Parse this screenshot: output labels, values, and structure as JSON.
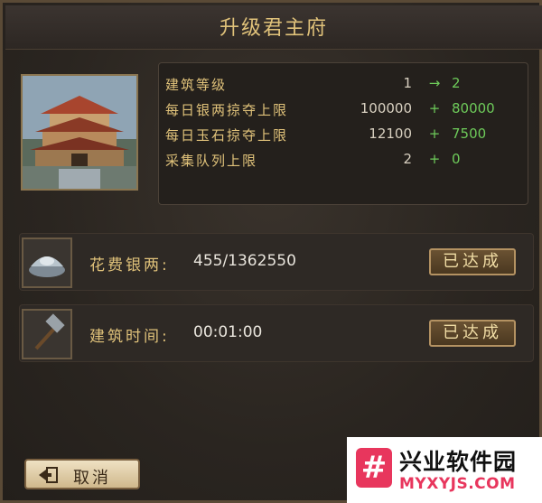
{
  "title": "升级君主府",
  "stats": [
    {
      "label": "建筑等级",
      "current": "1",
      "symbol": "→",
      "next": "2"
    },
    {
      "label": "每日银两掠夺上限",
      "current": "100000",
      "symbol": "+",
      "next": "80000"
    },
    {
      "label": "每日玉石掠夺上限",
      "current": "12100",
      "symbol": "+",
      "next": "7500"
    },
    {
      "label": "采集队列上限",
      "current": "2",
      "symbol": "+",
      "next": "0"
    }
  ],
  "requirements": [
    {
      "label": "花费银两:",
      "value": "455/1362550",
      "status": "已达成",
      "icon": "silver-ingot-icon"
    },
    {
      "label": "建筑时间:",
      "value": "00:01:00",
      "status": "已达成",
      "icon": "hammer-icon"
    }
  ],
  "cancel_label": "取消",
  "watermark": {
    "title": "兴业软件园",
    "url": "MYXYJS.COM",
    "logo": "#"
  },
  "colors": {
    "gold_text": "#e0c27a",
    "green_text": "#6ecb5a",
    "panel": "#24201c"
  }
}
